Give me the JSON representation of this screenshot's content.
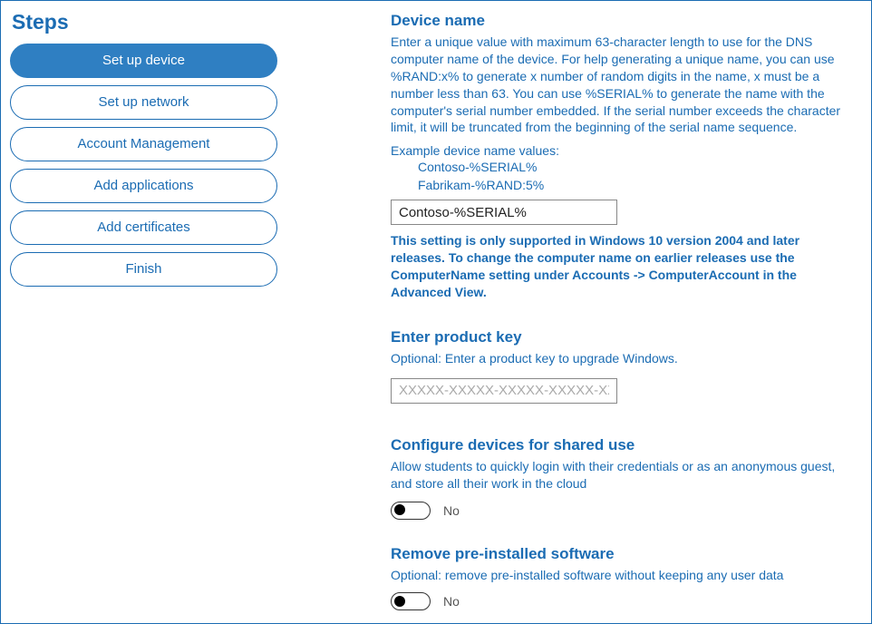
{
  "steps": {
    "title": "Steps",
    "items": [
      {
        "label": "Set up device",
        "active": true
      },
      {
        "label": "Set up network",
        "active": false
      },
      {
        "label": "Account Management",
        "active": false
      },
      {
        "label": "Add applications",
        "active": false
      },
      {
        "label": "Add certificates",
        "active": false
      },
      {
        "label": "Finish",
        "active": false
      }
    ]
  },
  "deviceName": {
    "title": "Device name",
    "desc": "Enter a unique value with maximum 63-character length to use for the DNS computer name of the device. For help generating a unique name, you can use %RAND:x% to generate x number of random digits in the name, x must be a number less than 63. You can use %SERIAL% to generate the name with the computer's serial number embedded. If the serial number exceeds the character limit, it will be truncated from the beginning of the serial name sequence.",
    "exampleLabel": "Example device name values:",
    "examples": [
      "Contoso-%SERIAL%",
      "Fabrikam-%RAND:5%"
    ],
    "value": "Contoso-%SERIAL%",
    "note": "This setting is only supported in Windows 10 version 2004 and later releases. To change the computer name on earlier releases use the ComputerName setting under Accounts -> ComputerAccount in the Advanced View."
  },
  "productKey": {
    "title": "Enter product key",
    "desc": "Optional: Enter a product key to upgrade Windows.",
    "placeholder": "XXXXX-XXXXX-XXXXX-XXXXX-XXXXX",
    "value": ""
  },
  "sharedUse": {
    "title": "Configure devices for shared use",
    "desc": "Allow students to quickly login with their credentials or as an anonymous guest, and store all their work in the cloud",
    "toggleLabel": "No"
  },
  "removeSoftware": {
    "title": "Remove pre-installed software",
    "desc": "Optional: remove pre-installed software without keeping any user data",
    "toggleLabel": "No"
  }
}
